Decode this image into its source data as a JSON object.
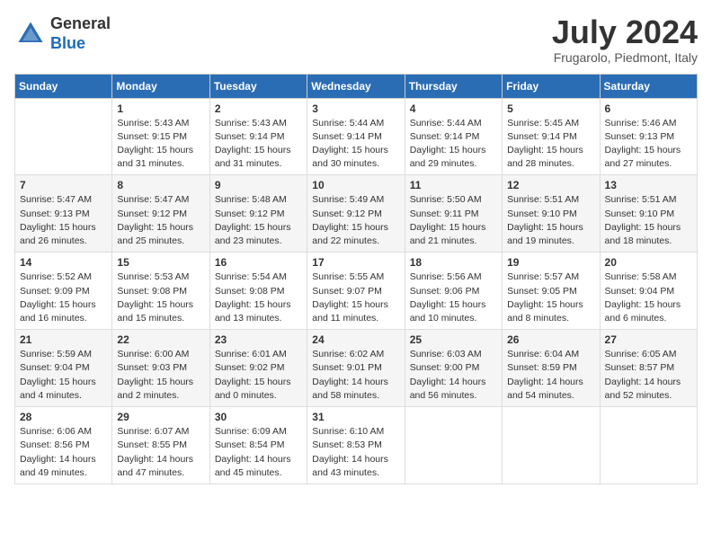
{
  "header": {
    "logo": {
      "general": "General",
      "blue": "Blue"
    },
    "title": "July 2024",
    "location": "Frugarolo, Piedmont, Italy"
  },
  "calendar": {
    "days_of_week": [
      "Sunday",
      "Monday",
      "Tuesday",
      "Wednesday",
      "Thursday",
      "Friday",
      "Saturday"
    ],
    "weeks": [
      [
        {
          "day": "",
          "info": ""
        },
        {
          "day": "1",
          "info": "Sunrise: 5:43 AM\nSunset: 9:15 PM\nDaylight: 15 hours\nand 31 minutes."
        },
        {
          "day": "2",
          "info": "Sunrise: 5:43 AM\nSunset: 9:14 PM\nDaylight: 15 hours\nand 31 minutes."
        },
        {
          "day": "3",
          "info": "Sunrise: 5:44 AM\nSunset: 9:14 PM\nDaylight: 15 hours\nand 30 minutes."
        },
        {
          "day": "4",
          "info": "Sunrise: 5:44 AM\nSunset: 9:14 PM\nDaylight: 15 hours\nand 29 minutes."
        },
        {
          "day": "5",
          "info": "Sunrise: 5:45 AM\nSunset: 9:14 PM\nDaylight: 15 hours\nand 28 minutes."
        },
        {
          "day": "6",
          "info": "Sunrise: 5:46 AM\nSunset: 9:13 PM\nDaylight: 15 hours\nand 27 minutes."
        }
      ],
      [
        {
          "day": "7",
          "info": "Sunrise: 5:47 AM\nSunset: 9:13 PM\nDaylight: 15 hours\nand 26 minutes."
        },
        {
          "day": "8",
          "info": "Sunrise: 5:47 AM\nSunset: 9:12 PM\nDaylight: 15 hours\nand 25 minutes."
        },
        {
          "day": "9",
          "info": "Sunrise: 5:48 AM\nSunset: 9:12 PM\nDaylight: 15 hours\nand 23 minutes."
        },
        {
          "day": "10",
          "info": "Sunrise: 5:49 AM\nSunset: 9:12 PM\nDaylight: 15 hours\nand 22 minutes."
        },
        {
          "day": "11",
          "info": "Sunrise: 5:50 AM\nSunset: 9:11 PM\nDaylight: 15 hours\nand 21 minutes."
        },
        {
          "day": "12",
          "info": "Sunrise: 5:51 AM\nSunset: 9:10 PM\nDaylight: 15 hours\nand 19 minutes."
        },
        {
          "day": "13",
          "info": "Sunrise: 5:51 AM\nSunset: 9:10 PM\nDaylight: 15 hours\nand 18 minutes."
        }
      ],
      [
        {
          "day": "14",
          "info": "Sunrise: 5:52 AM\nSunset: 9:09 PM\nDaylight: 15 hours\nand 16 minutes."
        },
        {
          "day": "15",
          "info": "Sunrise: 5:53 AM\nSunset: 9:08 PM\nDaylight: 15 hours\nand 15 minutes."
        },
        {
          "day": "16",
          "info": "Sunrise: 5:54 AM\nSunset: 9:08 PM\nDaylight: 15 hours\nand 13 minutes."
        },
        {
          "day": "17",
          "info": "Sunrise: 5:55 AM\nSunset: 9:07 PM\nDaylight: 15 hours\nand 11 minutes."
        },
        {
          "day": "18",
          "info": "Sunrise: 5:56 AM\nSunset: 9:06 PM\nDaylight: 15 hours\nand 10 minutes."
        },
        {
          "day": "19",
          "info": "Sunrise: 5:57 AM\nSunset: 9:05 PM\nDaylight: 15 hours\nand 8 minutes."
        },
        {
          "day": "20",
          "info": "Sunrise: 5:58 AM\nSunset: 9:04 PM\nDaylight: 15 hours\nand 6 minutes."
        }
      ],
      [
        {
          "day": "21",
          "info": "Sunrise: 5:59 AM\nSunset: 9:04 PM\nDaylight: 15 hours\nand 4 minutes."
        },
        {
          "day": "22",
          "info": "Sunrise: 6:00 AM\nSunset: 9:03 PM\nDaylight: 15 hours\nand 2 minutes."
        },
        {
          "day": "23",
          "info": "Sunrise: 6:01 AM\nSunset: 9:02 PM\nDaylight: 15 hours\nand 0 minutes."
        },
        {
          "day": "24",
          "info": "Sunrise: 6:02 AM\nSunset: 9:01 PM\nDaylight: 14 hours\nand 58 minutes."
        },
        {
          "day": "25",
          "info": "Sunrise: 6:03 AM\nSunset: 9:00 PM\nDaylight: 14 hours\nand 56 minutes."
        },
        {
          "day": "26",
          "info": "Sunrise: 6:04 AM\nSunset: 8:59 PM\nDaylight: 14 hours\nand 54 minutes."
        },
        {
          "day": "27",
          "info": "Sunrise: 6:05 AM\nSunset: 8:57 PM\nDaylight: 14 hours\nand 52 minutes."
        }
      ],
      [
        {
          "day": "28",
          "info": "Sunrise: 6:06 AM\nSunset: 8:56 PM\nDaylight: 14 hours\nand 49 minutes."
        },
        {
          "day": "29",
          "info": "Sunrise: 6:07 AM\nSunset: 8:55 PM\nDaylight: 14 hours\nand 47 minutes."
        },
        {
          "day": "30",
          "info": "Sunrise: 6:09 AM\nSunset: 8:54 PM\nDaylight: 14 hours\nand 45 minutes."
        },
        {
          "day": "31",
          "info": "Sunrise: 6:10 AM\nSunset: 8:53 PM\nDaylight: 14 hours\nand 43 minutes."
        },
        {
          "day": "",
          "info": ""
        },
        {
          "day": "",
          "info": ""
        },
        {
          "day": "",
          "info": ""
        }
      ]
    ]
  }
}
